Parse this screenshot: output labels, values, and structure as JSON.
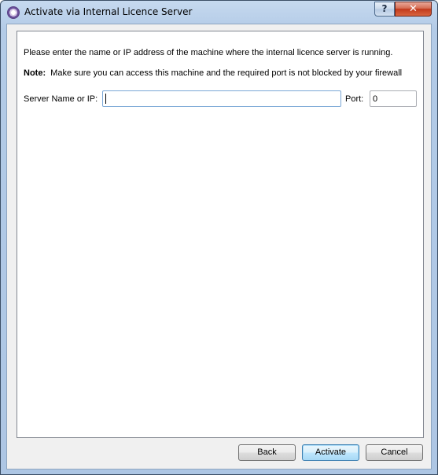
{
  "window": {
    "title": "Activate via Internal Licence Server",
    "help_label": "?",
    "close_label": "✕"
  },
  "content": {
    "intro": "Please enter the name or IP address of the machine where the internal licence server is running.",
    "note_label": "Note:",
    "note_text": "Make sure you can access this machine and the required port is not blocked by your firewall"
  },
  "form": {
    "server_label": "Server Name or IP:",
    "server_value": "",
    "port_label": "Port:",
    "port_value": "0"
  },
  "buttons": {
    "back": "Back",
    "activate": "Activate",
    "cancel": "Cancel"
  },
  "colors": {
    "accent": "#3c7fb1",
    "close": "#c2391c"
  },
  "icons": {
    "app": "app-logo-icon",
    "help": "help-icon",
    "close": "close-icon"
  }
}
